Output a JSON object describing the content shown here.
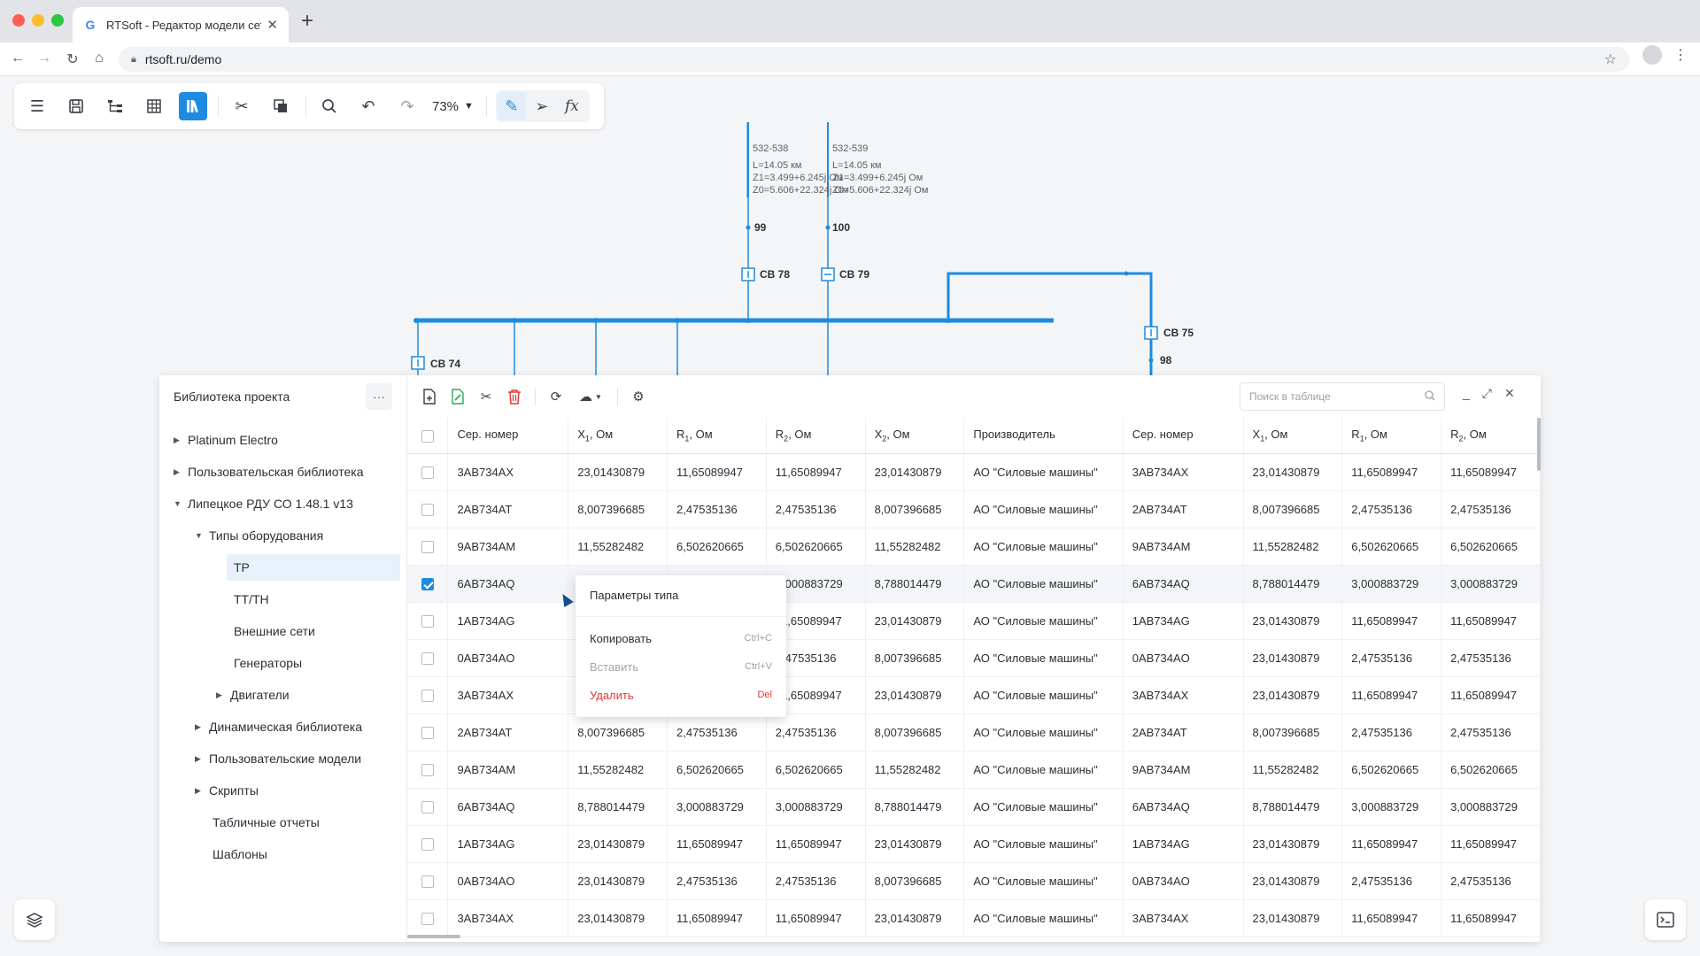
{
  "browser": {
    "tab_title": "RTSoft - Редактор модели сети",
    "url": "rtsoft.ru/demo",
    "traffic_colors": [
      "#ff5f57",
      "#febc2e",
      "#28c840"
    ]
  },
  "toolbar": {
    "zoom": "73%"
  },
  "diagram": {
    "line1": {
      "name": "532-538",
      "length": "L=14.05 км",
      "z1": "Z1=3.499+6.245j Ом",
      "z0": "Z0=5.606+22.324j Ом"
    },
    "line2": {
      "name": "532-539",
      "length": "L=14.05 км",
      "z1": "Z1=3.499+6.245j Ом",
      "z0": "Z0=5.606+22.324j Ом"
    },
    "node99": "99",
    "node100": "100",
    "node98": "98",
    "sw78": "СВ 78",
    "sw79": "СВ 79",
    "sw75": "СВ 75",
    "sw74": "СВ 74"
  },
  "library": {
    "title": "Библиотека проекта",
    "items": [
      {
        "label": "Platinum Electro"
      },
      {
        "label": "Пользовательская библиотека"
      },
      {
        "label": "Липецкое РДУ СО 1.48.1 v13"
      },
      {
        "label": "Типы оборудования"
      },
      {
        "label": "TP"
      },
      {
        "label": "TT/TH"
      },
      {
        "label": "Внешние сети"
      },
      {
        "label": "Генераторы"
      },
      {
        "label": "Двигатели"
      },
      {
        "label": "Динамическая библиотека"
      },
      {
        "label": "Пользовательские модели"
      },
      {
        "label": "Скрипты"
      },
      {
        "label": "Табличные отчеты"
      },
      {
        "label": "Шаблоны"
      }
    ]
  },
  "grid": {
    "search_placeholder": "Поиск в таблице",
    "columns": [
      {
        "base": "Сер. номер",
        "sub": "",
        "suffix": ""
      },
      {
        "base": "X",
        "sub": "1",
        "suffix": ", Ом"
      },
      {
        "base": "R",
        "sub": "1",
        "suffix": ", Ом"
      },
      {
        "base": "R",
        "sub": "2",
        "suffix": ", Ом"
      },
      {
        "base": "X",
        "sub": "2",
        "suffix": ", Ом"
      },
      {
        "base": "Производитель",
        "sub": "",
        "suffix": ""
      },
      {
        "base": "Сер. номер",
        "sub": "",
        "suffix": ""
      },
      {
        "base": "X",
        "sub": "1",
        "suffix": ", Ом"
      },
      {
        "base": "R",
        "sub": "1",
        "suffix": ", Ом"
      },
      {
        "base": "R",
        "sub": "2",
        "suffix": ", Ом"
      }
    ],
    "rows": [
      [
        "3AB734AX",
        "23,01430879",
        "11,65089947",
        "11,65089947",
        "23,01430879",
        "АО \"Силовые машины\"",
        "3AB734AX",
        "23,01430879",
        "11,65089947",
        "11,65089947"
      ],
      [
        "2AB734AT",
        "8,007396685",
        "2,47535136",
        "2,47535136",
        "8,007396685",
        "АО \"Силовые машины\"",
        "2AB734AT",
        "8,007396685",
        "2,47535136",
        "2,47535136"
      ],
      [
        "9AB734AM",
        "11,55282482",
        "6,502620665",
        "6,502620665",
        "11,55282482",
        "АО \"Силовые машины\"",
        "9AB734AM",
        "11,55282482",
        "6,502620665",
        "6,502620665"
      ],
      [
        "6AB734AQ",
        "8,788014479",
        "3,000883729",
        "3,000883729",
        "8,788014479",
        "АО \"Силовые машины\"",
        "6AB734AQ",
        "8,788014479",
        "3,000883729",
        "3,000883729"
      ],
      [
        "1AB734AG",
        "23,01430879",
        "11,65089947",
        "11,65089947",
        "23,01430879",
        "АО \"Силовые машины\"",
        "1AB734AG",
        "23,01430879",
        "11,65089947",
        "11,65089947"
      ],
      [
        "0AB734AO",
        "23,01430879",
        "2,47535136",
        "2,47535136",
        "8,007396685",
        "АО \"Силовые машины\"",
        "0AB734AO",
        "23,01430879",
        "2,47535136",
        "2,47535136"
      ],
      [
        "3AB734AX",
        "23,01430879",
        "11,65089947",
        "11,65089947",
        "23,01430879",
        "АО \"Силовые машины\"",
        "3AB734AX",
        "23,01430879",
        "11,65089947",
        "11,65089947"
      ],
      [
        "2AB734AT",
        "8,007396685",
        "2,47535136",
        "2,47535136",
        "8,007396685",
        "АО \"Силовые машины\"",
        "2AB734AT",
        "8,007396685",
        "2,47535136",
        "2,47535136"
      ],
      [
        "9AB734AM",
        "11,55282482",
        "6,502620665",
        "6,502620665",
        "11,55282482",
        "АО \"Силовые машины\"",
        "9AB734AM",
        "11,55282482",
        "6,502620665",
        "6,502620665"
      ],
      [
        "6AB734AQ",
        "8,788014479",
        "3,000883729",
        "3,000883729",
        "8,788014479",
        "АО \"Силовые машины\"",
        "6AB734AQ",
        "8,788014479",
        "3,000883729",
        "3,000883729"
      ],
      [
        "1AB734AG",
        "23,01430879",
        "11,65089947",
        "11,65089947",
        "23,01430879",
        "АО \"Силовые машины\"",
        "1AB734AG",
        "23,01430879",
        "11,65089947",
        "11,65089947"
      ],
      [
        "0AB734AO",
        "23,01430879",
        "2,47535136",
        "2,47535136",
        "8,007396685",
        "АО \"Силовые машины\"",
        "0AB734AO",
        "23,01430879",
        "2,47535136",
        "2,47535136"
      ],
      [
        "3AB734AX",
        "23,01430879",
        "11,65089947",
        "11,65089947",
        "23,01430879",
        "АО \"Силовые машины\"",
        "3AB734AX",
        "23,01430879",
        "11,65089947",
        "11,65089947"
      ]
    ],
    "checked_row": 3
  },
  "context_menu": {
    "params": "Параметры типа",
    "copy": "Копировать",
    "copy_kb": "Ctrl+C",
    "paste": "Вставить",
    "paste_kb": "Ctrl+V",
    "delete": "Удалить",
    "delete_kb": "Del"
  },
  "colors": {
    "accent": "#1d8ce0",
    "danger": "#e03a3a"
  }
}
